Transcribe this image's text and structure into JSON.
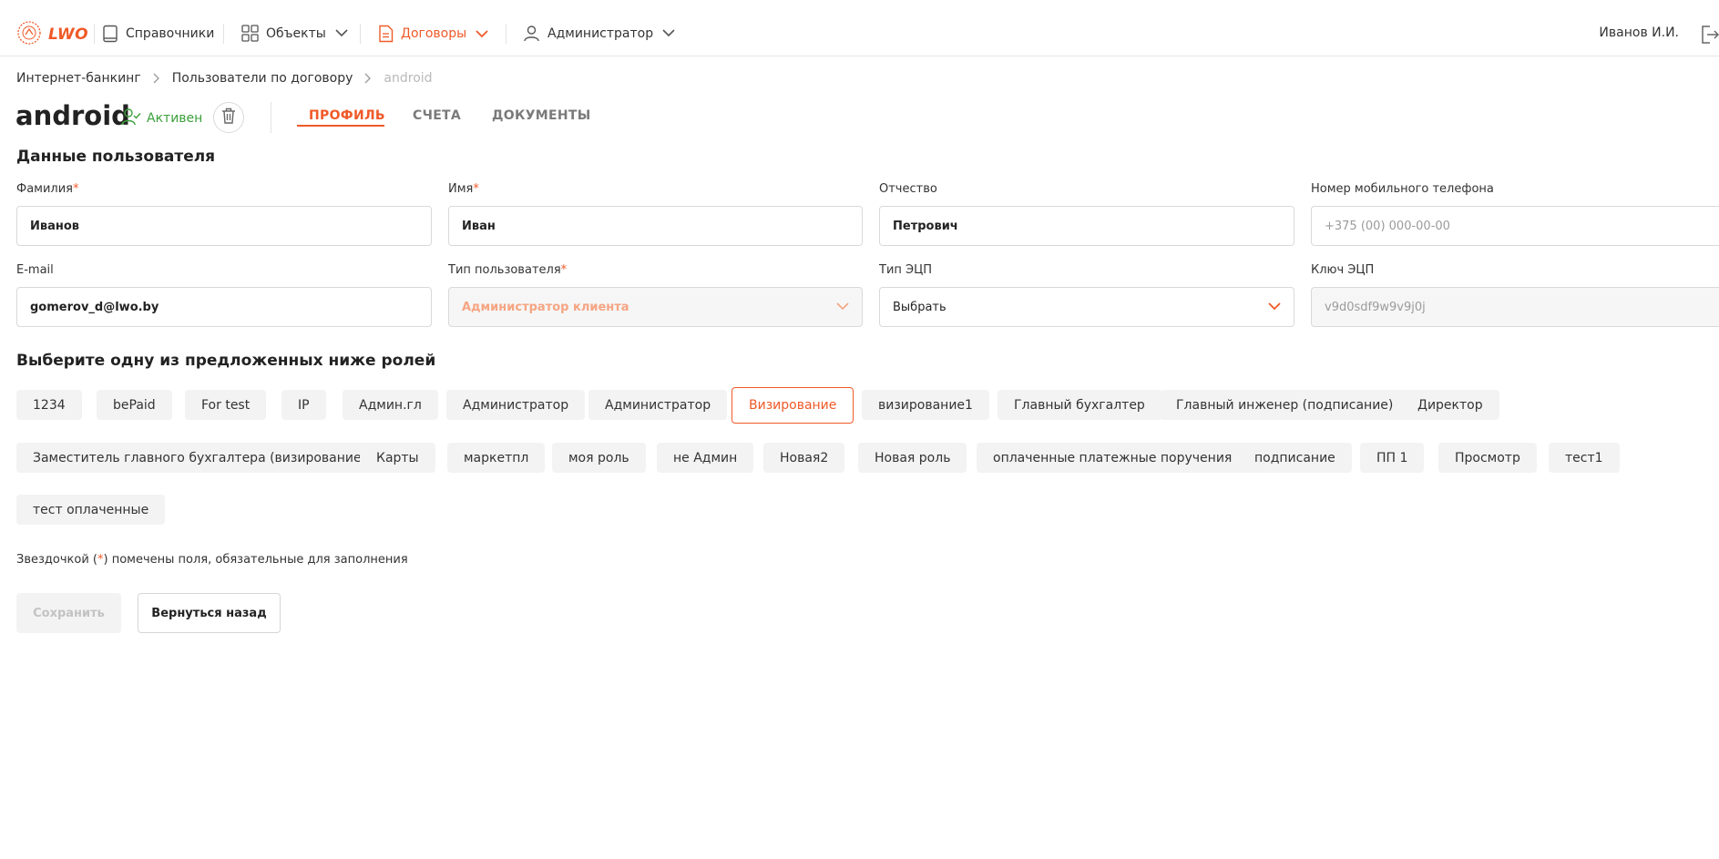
{
  "header": {
    "logo_text": "LWO",
    "nav": [
      {
        "label": "Справочники",
        "icon": "book-icon"
      },
      {
        "label": "Объекты",
        "icon": "grid-icon"
      },
      {
        "label": "Договоры",
        "icon": "document-icon"
      },
      {
        "label": "Администратор",
        "icon": "user-icon"
      }
    ],
    "user": "Иванов И.И."
  },
  "breadcrumb": [
    "Интернет-банкинг",
    "Пользователи по договору",
    "android"
  ],
  "page": {
    "title": "android",
    "status": "Активен",
    "tabs": [
      "ПРОФИЛЬ",
      "СЧЕТА",
      "ДОКУМЕНТЫ"
    ],
    "active_tab": "ПРОФИЛЬ"
  },
  "user_data": {
    "section_title": "Данные пользователя",
    "surname": {
      "label": "Фамилия",
      "required": "*",
      "value": "Иванов"
    },
    "name": {
      "label": "Имя",
      "required": "*",
      "value": "Иван"
    },
    "patronymic": {
      "label": "Отчество",
      "value": "Петрович"
    },
    "phone": {
      "label": "Номер мобильного телефона",
      "placeholder": "+375 (00) 000-00-00"
    },
    "email": {
      "label": "E-mail",
      "value": "gomerov_d@lwo.by"
    },
    "user_type": {
      "label": "Тип пользователя",
      "required": "*",
      "value": "Администратор клиента"
    },
    "ecp_type": {
      "label": "Тип ЭЦП",
      "value": "Выбрать"
    },
    "ecp_key": {
      "label": "Ключ ЭЦП",
      "value": "v9d0sdf9w9v9j0j"
    }
  },
  "roles": {
    "section_title": "Выберите одну из предложенных ниже ролей",
    "items": [
      "1234",
      "bePaid",
      "For test",
      "IP",
      "Админ.гл",
      "Администратор",
      "Администратор",
      "Визирование",
      "визирование1",
      "Главный бухгалтер",
      "Главный инженер (подписание)",
      "Директор",
      "Заместитель главного бухгалтера (визирование)",
      "Карты",
      "маркетпл",
      "моя роль",
      "не Админ",
      "Новая2",
      "Новая роль",
      "оплаченные платежные поручения",
      "подписание",
      "ПП 1",
      "Просмотр",
      "тест1",
      "тест оплаченные"
    ],
    "selected": "Визирование"
  },
  "footer": {
    "note_before": "Звездочкой (",
    "note_star": "*",
    "note_after": ") помечены поля, обязательные для заполнения",
    "save_label": "Сохранить",
    "back_label": "Вернуться назад"
  },
  "colors": {
    "accent": "#ef5a28",
    "active_status": "#3ba03b"
  }
}
